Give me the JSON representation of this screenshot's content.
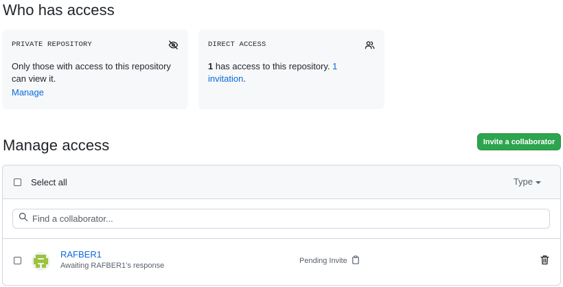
{
  "who_has_access": {
    "heading": "Who has access",
    "private_card": {
      "title": "PRIVATE REPOSITORY",
      "icon": "eye-closed-icon",
      "text": "Only those with access to this repository can view it.",
      "manage_link": "Manage"
    },
    "direct_card": {
      "title": "DIRECT ACCESS",
      "icon": "people-icon",
      "count": "1",
      "text": " has access to this repository. ",
      "invitation_link": "1 invitation",
      "trailing": "."
    }
  },
  "manage_access": {
    "heading": "Manage access",
    "invite_button": "Invite a collaborator",
    "select_all": "Select all",
    "type_filter": "Type",
    "search_placeholder": "Find a collaborator...",
    "collaborators": [
      {
        "name": "RAFBER1",
        "subtitle": "Awaiting RAFBER1’s response",
        "status": "Pending Invite",
        "status_icon": "clipboard-icon",
        "remove_icon": "trash-icon"
      }
    ]
  },
  "colors": {
    "accent_link": "#0969da",
    "primary_button": "#2da44e",
    "card_bg": "#f6f8fa",
    "avatar_green": "#9ac33e"
  }
}
